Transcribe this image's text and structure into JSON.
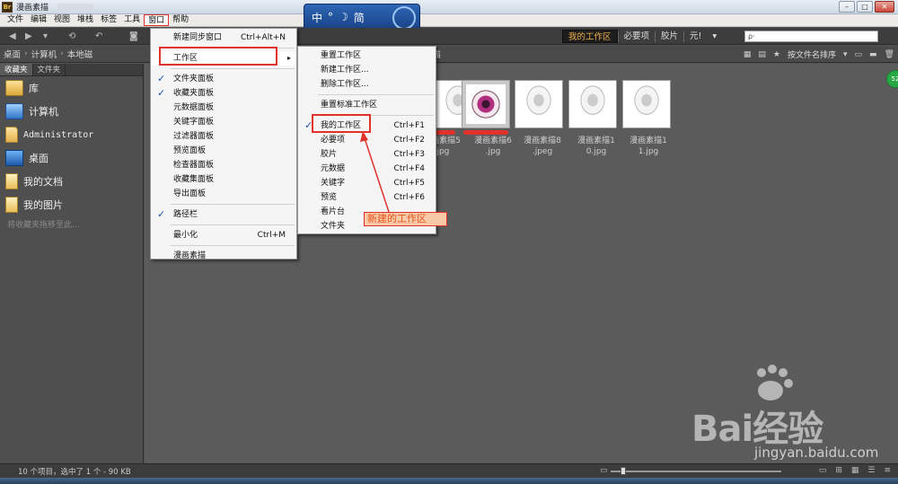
{
  "window": {
    "title": "漫画素描",
    "logo": "Br",
    "controls": {
      "minimize": "–",
      "maximize": "□",
      "close": "✕"
    }
  },
  "menubar": {
    "items": [
      "文件",
      "编辑",
      "视图",
      "堆栈",
      "标签",
      "工具",
      "窗口",
      "帮助"
    ],
    "active": "窗口"
  },
  "ime": {
    "label": "中",
    "extra": "简"
  },
  "toolbar": {
    "workspaces": [
      "我的工作区",
      "必要项",
      "胶片",
      "元!"
    ],
    "active_workspace": "我的工作区",
    "search_placeholder": "ρ·"
  },
  "pathbar": {
    "crumbs": [
      "桌面",
      "计算机",
      "本地磁",
      "漫画素描"
    ],
    "sort_label": "按文件名排序"
  },
  "leftpanel": {
    "tabs": [
      "收藏夹",
      "文件夹"
    ],
    "favorites": [
      {
        "label": "库",
        "icon": "library-icon"
      },
      {
        "label": "计算机",
        "icon": "computer-icon"
      },
      {
        "label": "Administrator",
        "icon": "user-folder-icon"
      },
      {
        "label": "桌面",
        "icon": "desktop-icon"
      },
      {
        "label": "我的文档",
        "icon": "documents-icon"
      },
      {
        "label": "我的图片",
        "icon": "pictures-icon"
      }
    ],
    "hint": "将收藏夹拖移至此..."
  },
  "thumbnails": [
    {
      "line1": "漫画素描5",
      "line2": ".jpg"
    },
    {
      "line1": "漫画素描6",
      "line2": ".jpg"
    },
    {
      "line1": "漫画素描8",
      "line2": ".jpeg"
    },
    {
      "line1": "漫画素描1",
      "line2": "0.jpg"
    },
    {
      "line1": "漫画素描1",
      "line2": "1.jpg"
    }
  ],
  "window_menu": {
    "items": [
      {
        "label": "新建同步窗口",
        "shortcut": "Ctrl+Alt+N"
      },
      {
        "label": "工作区",
        "submenu": "▸"
      },
      {
        "label": "文件夹面板",
        "checked": true
      },
      {
        "label": "收藏夹面板",
        "checked": true
      },
      {
        "label": "元数据面板"
      },
      {
        "label": "关键字面板"
      },
      {
        "label": "过滤器面板"
      },
      {
        "label": "预览面板"
      },
      {
        "label": "检查器面板"
      },
      {
        "label": "收藏集面板"
      },
      {
        "label": "导出面板"
      },
      {
        "label": "路径栏",
        "checked": true
      },
      {
        "label": "最小化",
        "shortcut": "Ctrl+M"
      },
      {
        "label": "漫画素描"
      }
    ]
  },
  "workspace_menu": {
    "items": [
      {
        "label": "重置工作区"
      },
      {
        "label": "新建工作区..."
      },
      {
        "label": "删除工作区..."
      },
      {
        "label": "重置标准工作区"
      },
      {
        "label": "我的工作区",
        "shortcut": "Ctrl+F1",
        "checked": true
      },
      {
        "label": "必要项",
        "shortcut": "Ctrl+F2"
      },
      {
        "label": "胶片",
        "shortcut": "Ctrl+F3"
      },
      {
        "label": "元数据",
        "shortcut": "Ctrl+F4"
      },
      {
        "label": "关键字",
        "shortcut": "Ctrl+F5"
      },
      {
        "label": "预览",
        "shortcut": "Ctrl+F6"
      },
      {
        "label": "看片台"
      },
      {
        "label": "文件夹"
      }
    ]
  },
  "annotation": {
    "text": "新建的工作区"
  },
  "statusbar": {
    "text": "10 个项目，选中了 1 个 - 90 KB"
  },
  "avatar": "52",
  "watermark": {
    "brand": "Bai经验",
    "url": "jingyan.baidu.com"
  },
  "colors": {
    "accent_red": "#e0322a",
    "workspace_active": "#f0b04a",
    "check_blue": "#1b4fb5"
  }
}
